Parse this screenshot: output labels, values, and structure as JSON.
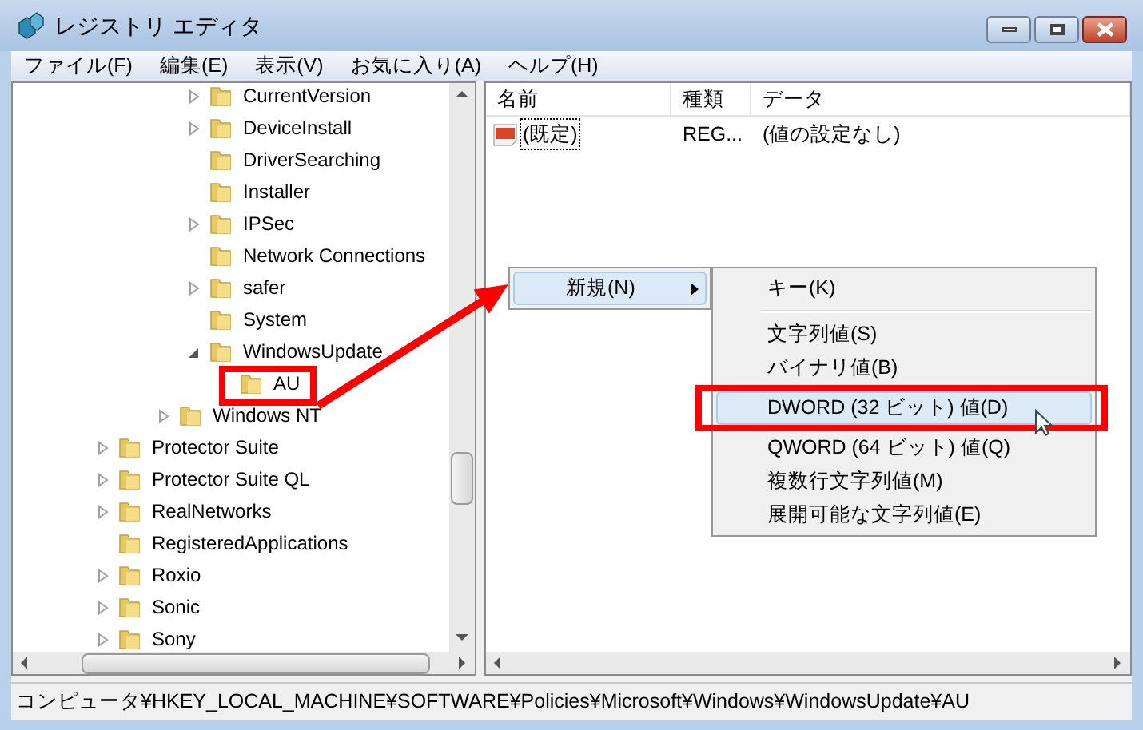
{
  "window": {
    "title": "レジストリ エディタ"
  },
  "menu_bar": [
    "ファイル(F)",
    "編集(E)",
    "表示(V)",
    "お気に入り(A)",
    "ヘルプ(H)"
  ],
  "tree": {
    "items": [
      {
        "children": [
          {
            "children": [
              {
                "children": [
                  {
                    "label": "CurrentVersion",
                    "kind": "collapsed"
                  },
                  {
                    "label": "DeviceInstall",
                    "kind": "collapsed"
                  },
                  {
                    "label": "DriverSearching",
                    "kind": "leaf"
                  },
                  {
                    "label": "Installer",
                    "kind": "leaf"
                  },
                  {
                    "label": "IPSec",
                    "kind": "collapsed"
                  },
                  {
                    "label": "Network Connections",
                    "kind": "leaf"
                  },
                  {
                    "label": "safer",
                    "kind": "collapsed"
                  },
                  {
                    "label": "System",
                    "kind": "leaf"
                  },
                  {
                    "label": "WindowsUpdate",
                    "kind": "expanded",
                    "children": [
                      {
                        "label": "AU"
                      }
                    ]
                  }
                ]
              },
              {
                "label": "Windows NT",
                "kind": "collapsed"
              }
            ]
          }
        ]
      },
      {
        "label": "Protector Suite",
        "kind": "collapsed"
      },
      {
        "label": "Protector Suite QL",
        "kind": "collapsed"
      },
      {
        "label": "RealNetworks",
        "kind": "collapsed"
      },
      {
        "label": "RegisteredApplications",
        "kind": "leaf"
      },
      {
        "label": "Roxio",
        "kind": "collapsed"
      },
      {
        "label": "Sonic",
        "kind": "collapsed"
      },
      {
        "label": "Sony",
        "kind": "collapsed"
      }
    ]
  },
  "values_pane": {
    "columns": [
      "名前",
      "種類",
      "データ"
    ],
    "rows": [
      {
        "name": "(既定)",
        "type": "REG...",
        "data": "(値の設定なし)",
        "focused": true
      }
    ]
  },
  "context_menu": {
    "items": [
      {
        "label": "新規(N)",
        "selected": true,
        "has_submenu": true
      }
    ]
  },
  "submenu": {
    "items": [
      {
        "kind": "item",
        "label": "キー(K)",
        "selected": false
      },
      {
        "kind": "separator"
      },
      {
        "kind": "item",
        "label": "文字列値(S)",
        "selected": false
      },
      {
        "kind": "item",
        "label": "バイナリ値(B)",
        "selected": false
      },
      {
        "kind": "item",
        "label": "DWORD (32 ビット) 値(D)",
        "selected": true
      },
      {
        "kind": "item",
        "label": "QWORD (64 ビット) 値(Q)",
        "selected": false
      },
      {
        "kind": "item",
        "label": "複数行文字列値(M)",
        "selected": false
      },
      {
        "kind": "item",
        "label": "展開可能な文字列値(E)",
        "selected": false
      }
    ]
  },
  "status_bar": "コンピュータ¥HKEY_LOCAL_MACHINE¥SOFTWARE¥Policies¥Microsoft¥Windows¥WindowsUpdate¥AU"
}
